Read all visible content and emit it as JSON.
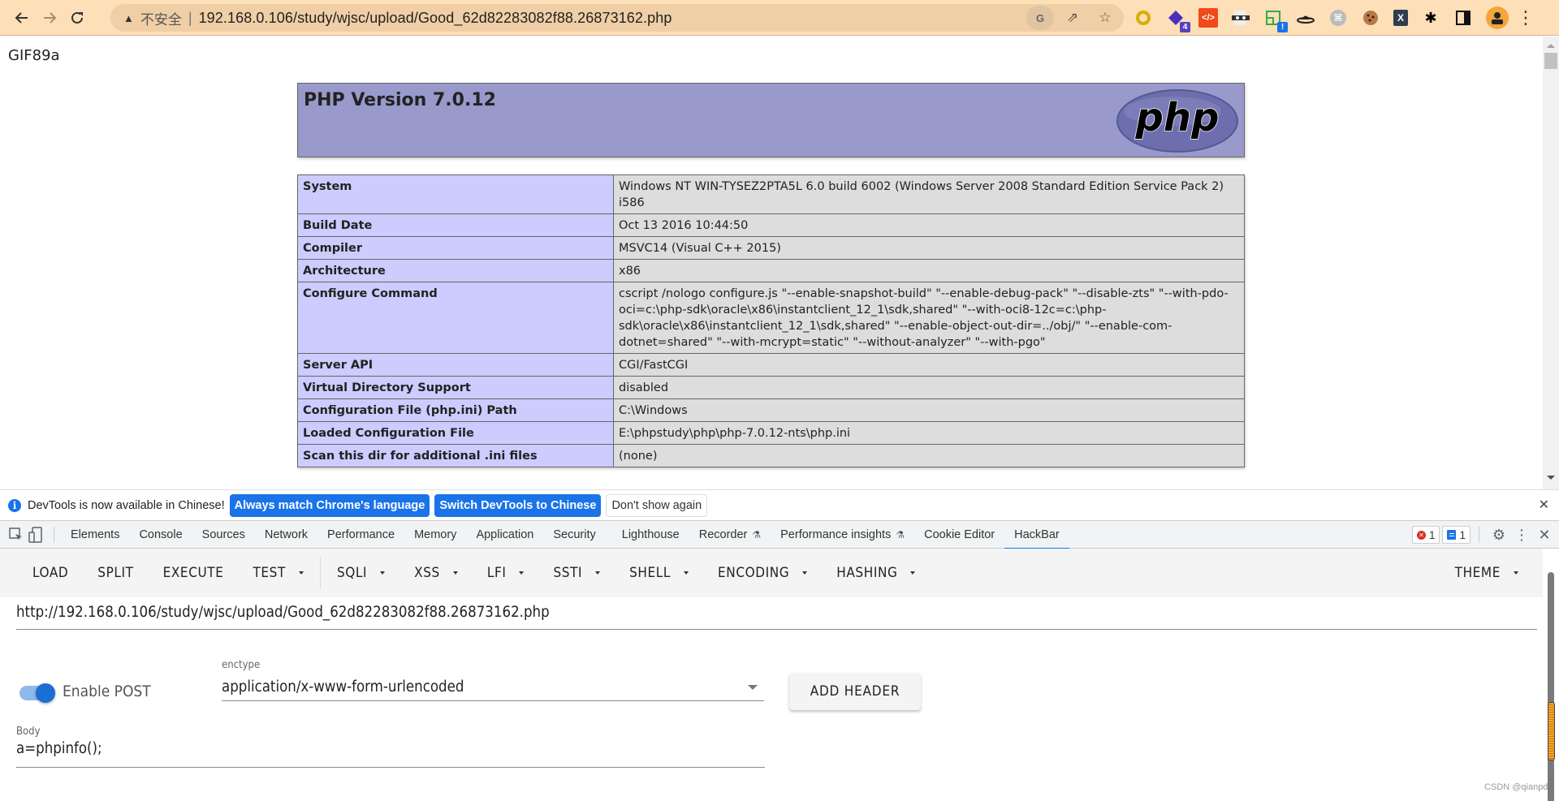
{
  "browser": {
    "security_label": "不安全",
    "url": "192.168.0.106/study/wjsc/upload/Good_62d82283082f88.26873162.php",
    "extensions": [
      {
        "name": "yellow-ring-extension",
        "badge": ""
      },
      {
        "name": "purple-diamond-extension",
        "badge": "4"
      },
      {
        "name": "code-extension",
        "badge": ""
      },
      {
        "name": "mask-extension",
        "badge": ""
      },
      {
        "name": "green-window-extension",
        "badge": "!"
      },
      {
        "name": "hat-extension",
        "badge": ""
      },
      {
        "name": "command-extension",
        "badge": ""
      },
      {
        "name": "cookie-extension",
        "badge": ""
      },
      {
        "name": "x-extension",
        "badge": "X"
      }
    ]
  },
  "page": {
    "gif_header": "GIF89a",
    "php_title": "PHP Version 7.0.12",
    "php_logo_text": "php",
    "rows": [
      {
        "key": "System",
        "value": "Windows NT WIN-TYSEZ2PTA5L 6.0 build 6002 (Windows Server 2008 Standard Edition Service Pack 2) i586"
      },
      {
        "key": "Build Date",
        "value": "Oct 13 2016 10:44:50"
      },
      {
        "key": "Compiler",
        "value": "MSVC14 (Visual C++ 2015)"
      },
      {
        "key": "Architecture",
        "value": "x86"
      },
      {
        "key": "Configure Command",
        "value": "cscript /nologo configure.js \"--enable-snapshot-build\" \"--enable-debug-pack\" \"--disable-zts\" \"--with-pdo-oci=c:\\php-sdk\\oracle\\x86\\instantclient_12_1\\sdk,shared\" \"--with-oci8-12c=c:\\php-sdk\\oracle\\x86\\instantclient_12_1\\sdk,shared\" \"--enable-object-out-dir=../obj/\" \"--enable-com-dotnet=shared\" \"--with-mcrypt=static\" \"--without-analyzer\" \"--with-pgo\""
      },
      {
        "key": "Server API",
        "value": "CGI/FastCGI"
      },
      {
        "key": "Virtual Directory Support",
        "value": "disabled"
      },
      {
        "key": "Configuration File (php.ini) Path",
        "value": "C:\\Windows"
      },
      {
        "key": "Loaded Configuration File",
        "value": "E:\\phpstudy\\php\\php-7.0.12-nts\\php.ini"
      },
      {
        "key": "Scan this dir for additional .ini files",
        "value": "(none)"
      }
    ]
  },
  "devtools": {
    "banner": {
      "message": "DevTools is now available in Chinese!",
      "btn_match": "Always match Chrome's language",
      "btn_switch": "Switch DevTools to Chinese",
      "btn_dismiss": "Don't show again"
    },
    "tabs": [
      {
        "label": "Elements",
        "experimental": false,
        "active": false
      },
      {
        "label": "Console",
        "experimental": false,
        "active": false
      },
      {
        "label": "Sources",
        "experimental": false,
        "active": false
      },
      {
        "label": "Network",
        "experimental": false,
        "active": false
      },
      {
        "label": "Performance",
        "experimental": false,
        "active": false
      },
      {
        "label": "Memory",
        "experimental": false,
        "active": false
      },
      {
        "label": "Application",
        "experimental": false,
        "active": false
      },
      {
        "label": "Security",
        "experimental": false,
        "active": false
      },
      {
        "label": "Lighthouse",
        "experimental": false,
        "active": false
      },
      {
        "label": "Recorder",
        "experimental": true,
        "active": false
      },
      {
        "label": "Performance insights",
        "experimental": true,
        "active": false
      },
      {
        "label": "Cookie Editor",
        "experimental": false,
        "active": false
      },
      {
        "label": "HackBar",
        "experimental": false,
        "active": true
      }
    ],
    "error_count": "1",
    "message_count": "1"
  },
  "hackbar": {
    "toolbar": {
      "load": "LOAD",
      "split": "SPLIT",
      "execute": "EXECUTE",
      "test": "TEST",
      "menus": [
        "SQLI",
        "XSS",
        "LFI",
        "SSTI",
        "SHELL",
        "ENCODING",
        "HASHING"
      ],
      "theme": "THEME"
    },
    "url": "http://192.168.0.106/study/wjsc/upload/Good_62d82283082f88.26873162.php",
    "enable_post_label": "Enable POST",
    "enable_post": true,
    "enctype_label": "enctype",
    "enctype_value": "application/x-www-form-urlencoded",
    "add_header": "ADD HEADER",
    "body_label": "Body",
    "body_value": "a=phpinfo();"
  },
  "watermark": "CSDN @qianpd"
}
